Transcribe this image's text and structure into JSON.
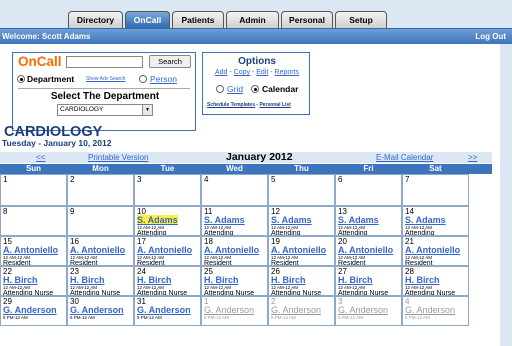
{
  "nav": {
    "tabs": [
      {
        "label": "Directory",
        "active": false
      },
      {
        "label": "OnCall",
        "active": true
      },
      {
        "label": "Patients",
        "active": false
      },
      {
        "label": "Admin",
        "active": false
      },
      {
        "label": "Personal",
        "active": false
      },
      {
        "label": "Setup",
        "active": false
      }
    ]
  },
  "welcome_bar": {
    "welcome": "Welcome: Scott Adams",
    "logout": "Log Out"
  },
  "oncall_panel": {
    "title": "OnCall",
    "search_value": "",
    "search_button": "Search",
    "department_label": "Department",
    "adv_search_link": "Show Adv Search",
    "person_link": "Person",
    "select_title": "Select The Department",
    "selected_department": "CARDIOLOGY"
  },
  "options_panel": {
    "title": "Options",
    "add": "Add",
    "copy": "Copy",
    "edit": "Edit",
    "reports": "Reports",
    "grid": "Grid",
    "calendar": "Calendar",
    "schedule_templates": "Schedule Templates",
    "personal_list": "Personal List"
  },
  "header": {
    "department": "CARDIOLOGY",
    "date": "Tuesday - January 10, 2012"
  },
  "calendar": {
    "prev": "<<",
    "printable": "Printable Version",
    "month": "January 2012",
    "email": "E-Mail Calendar",
    "next": ">>",
    "days": [
      "Sun",
      "Mon",
      "Tue",
      "Wed",
      "Thu",
      "Fri",
      "Sat"
    ],
    "weeks": [
      [
        {
          "day": "1"
        },
        {
          "day": "2"
        },
        {
          "day": "3"
        },
        {
          "day": "4"
        },
        {
          "day": "5"
        },
        {
          "day": "6"
        },
        {
          "day": "7"
        }
      ],
      [
        {
          "day": "8"
        },
        {
          "day": "9"
        },
        {
          "day": "10",
          "name": "S. Adams",
          "time": "12 AM-12 AM",
          "role": "Attending",
          "today": true
        },
        {
          "day": "11",
          "name": "S. Adams",
          "time": "12 AM-12 AM",
          "role": "Attending"
        },
        {
          "day": "12",
          "name": "S. Adams",
          "time": "12 AM-12 AM",
          "role": "Attending"
        },
        {
          "day": "13",
          "name": "S. Adams",
          "time": "12 AM-12 AM",
          "role": "Attending"
        },
        {
          "day": "14",
          "name": "S. Adams",
          "time": "12 AM-12 AM",
          "role": "Attending"
        }
      ],
      [
        {
          "day": "15",
          "name": "A. Antoniello",
          "time": "12 AM-12 AM",
          "role": "Resident"
        },
        {
          "day": "16",
          "name": "A. Antoniello",
          "time": "12 AM-12 AM",
          "role": "Resident"
        },
        {
          "day": "17",
          "name": "A. Antoniello",
          "time": "12 AM-12 AM",
          "role": "Resident"
        },
        {
          "day": "18",
          "name": "A. Antoniello",
          "time": "12 AM-12 AM",
          "role": "Resident"
        },
        {
          "day": "19",
          "name": "A. Antoniello",
          "time": "12 AM-12 AM",
          "role": "Resident"
        },
        {
          "day": "20",
          "name": "A. Antoniello",
          "time": "12 AM-12 AM",
          "role": "Resident"
        },
        {
          "day": "21",
          "name": "A. Antoniello",
          "time": "12 AM-12 AM",
          "role": "Resident"
        }
      ],
      [
        {
          "day": "22",
          "name": "H. Birch",
          "time": "12 AM-12 AM",
          "role": "Attending Nurse"
        },
        {
          "day": "23",
          "name": "H. Birch",
          "time": "12 AM-12 AM",
          "role": "Attending Nurse"
        },
        {
          "day": "24",
          "name": "H. Birch",
          "time": "12 AM-12 AM",
          "role": "Attending Nurse"
        },
        {
          "day": "25",
          "name": "H. Birch",
          "time": "12 AM-12 AM",
          "role": "Attending Nurse"
        },
        {
          "day": "26",
          "name": "H. Birch",
          "time": "12 AM-12 AM",
          "role": "Attending Nurse"
        },
        {
          "day": "27",
          "name": "H. Birch",
          "time": "12 AM-12 AM",
          "role": "Attending Nurse"
        },
        {
          "day": "28",
          "name": "H. Birch",
          "time": "12 AM-12 AM",
          "role": "Attending Nurse"
        }
      ],
      [
        {
          "day": "29",
          "name": "G. Anderson",
          "time": "5 PM-12 AM"
        },
        {
          "day": "30",
          "name": "G. Anderson",
          "time": "5 PM-12 AM"
        },
        {
          "day": "31",
          "name": "G. Anderson",
          "time": "5 PM-12 AM"
        },
        {
          "day": "1",
          "name": "G. Anderson",
          "time": "5 PM-12 AM",
          "faded": true
        },
        {
          "day": "2",
          "name": "G. Anderson",
          "time": "5 PM-12 AM",
          "faded": true
        },
        {
          "day": "3",
          "name": "G. Anderson",
          "time": "5 PM-12 AM",
          "faded": true
        },
        {
          "day": "4",
          "name": "G. Anderson",
          "time": "5 PM-12 AM",
          "faded": true
        }
      ]
    ]
  }
}
